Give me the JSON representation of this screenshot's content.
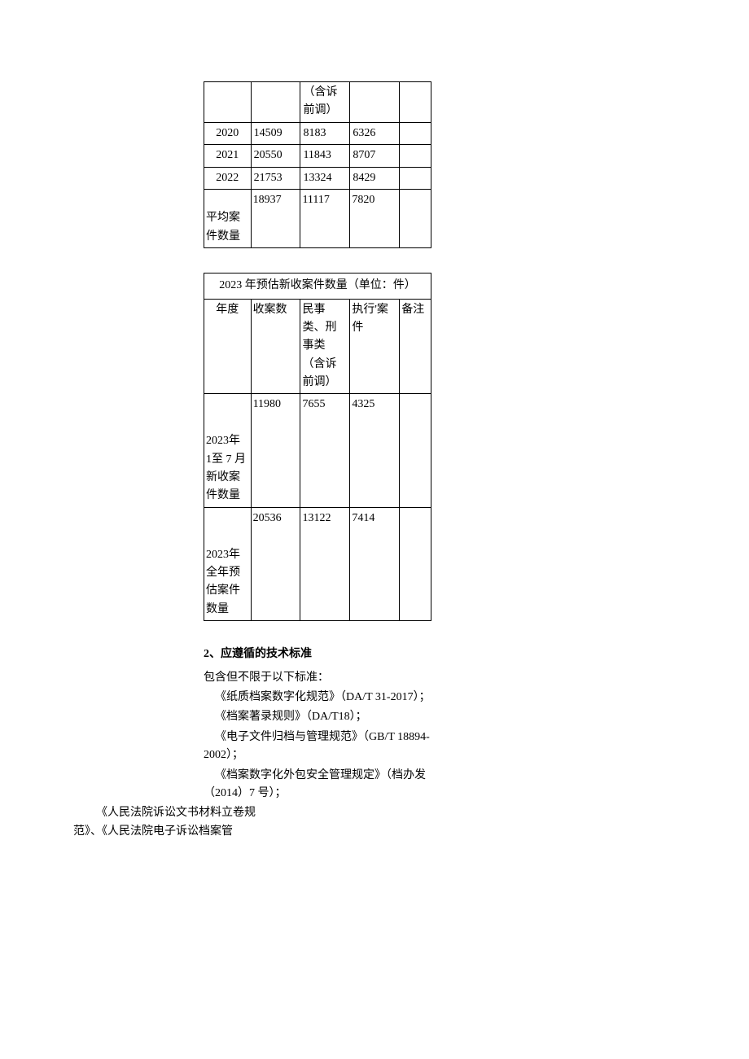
{
  "table1": {
    "header": {
      "col3": "（含诉前调）"
    },
    "rows": [
      {
        "year": "2020",
        "count": "14509",
        "civil": "8183",
        "exec": "6326",
        "note": ""
      },
      {
        "year": "2021",
        "count": "20550",
        "civil": "11843",
        "exec": "8707",
        "note": ""
      },
      {
        "year": "2022",
        "count": "21753",
        "civil": "13324",
        "exec": "8429",
        "note": ""
      },
      {
        "year": "平均案件数量",
        "count": "18937",
        "civil": "11117",
        "exec": "7820",
        "note": ""
      }
    ]
  },
  "table2": {
    "title": "2023 年预估新收案件数量（单位：件）",
    "header": {
      "year": "年度",
      "count": "收案数",
      "civil": "民事类、刑事类（含诉前调）",
      "exec": "执行'案件",
      "note": "备注"
    },
    "rows": [
      {
        "year": "2023年 1至 7 月新收案件数量",
        "count": "11980",
        "civil": "7655",
        "exec": "4325",
        "note": ""
      },
      {
        "year": "2023年全年预估案件数量",
        "count": "20536",
        "civil": "13122",
        "exec": "7414",
        "note": ""
      }
    ]
  },
  "section": {
    "heading": "2、应遵循的技术标准",
    "intro": "包含但不限于以下标准：",
    "items": [
      "《纸质档案数字化规范》（DA/T 31-2017）；",
      "《档案著录规则》（DA/T18）；",
      "《电子文件归档与管理规范》（GB/T 18894-2002）；",
      "《档案数字化外包安全管理规定》（档办发（2014）7 号）；"
    ],
    "outdent1": "《人民法院诉讼文书材料立卷规",
    "outdent2": "范》、《人民法院电子诉讼档案管"
  }
}
